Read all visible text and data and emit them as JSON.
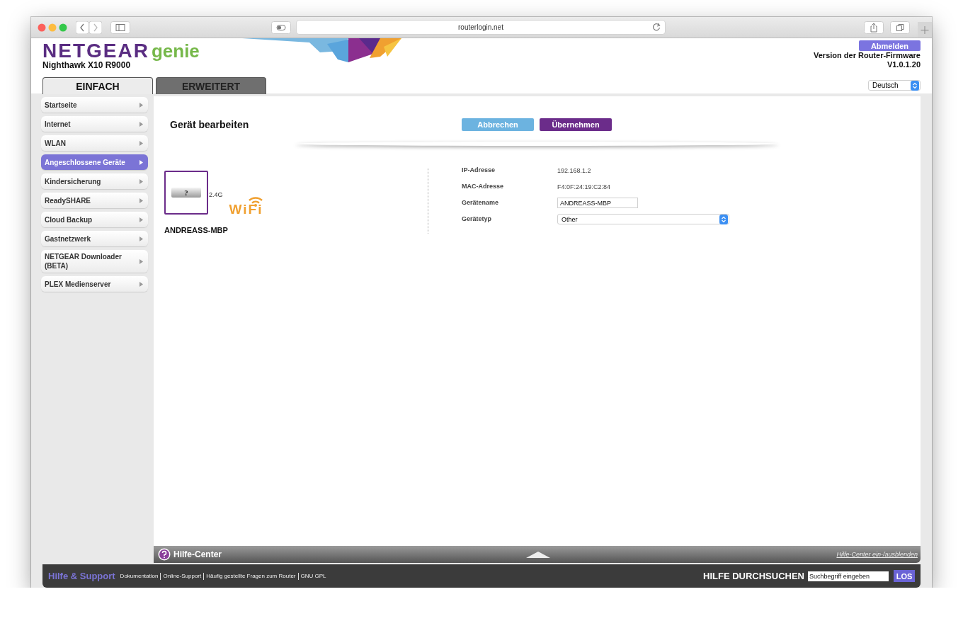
{
  "browser": {
    "url": "routerlogin.net"
  },
  "header": {
    "brand": "NETGEAR",
    "product": "genie",
    "model": "Nighthawk X10 R9000",
    "logout": "Abmelden",
    "firmware_label": "Version der Router-Firmware",
    "firmware_version": "V1.0.1.20",
    "language": "Deutsch"
  },
  "tabs": [
    {
      "label": "EINFACH",
      "selected": true
    },
    {
      "label": "ERWEITERT",
      "selected": false
    }
  ],
  "sidebar": {
    "items": [
      {
        "label": "Startseite",
        "selected": false
      },
      {
        "label": "Internet",
        "selected": false
      },
      {
        "label": "WLAN",
        "selected": false
      },
      {
        "label": "Angeschlossene Geräte",
        "selected": true
      },
      {
        "label": "Kindersicherung",
        "selected": false
      },
      {
        "label": "ReadySHARE",
        "selected": false
      },
      {
        "label": "Cloud Backup",
        "selected": false
      },
      {
        "label": "Gastnetzwerk",
        "selected": false
      },
      {
        "label": "NETGEAR Downloader (BETA)",
        "selected": false
      },
      {
        "label": "PLEX Medienserver",
        "selected": false
      }
    ]
  },
  "main": {
    "title": "Gerät bearbeiten",
    "buttons": [
      {
        "label": "Abbrechen",
        "kind": "cancel"
      },
      {
        "label": "Übernehmen",
        "kind": "apply"
      }
    ],
    "device": {
      "mark": "?",
      "band": "2.4G",
      "wifi": "WiFi",
      "name": "ANDREASS-MBP"
    },
    "fields": [
      {
        "label": "IP-Adresse",
        "kind": "text",
        "value": "192.168.1.2"
      },
      {
        "label": "MAC-Adresse",
        "kind": "text",
        "value": "F4:0F:24:19:C2:84"
      },
      {
        "label": "Gerätename",
        "kind": "input",
        "value": "ANDREASS-MBP"
      },
      {
        "label": "Gerätetyp",
        "kind": "select",
        "value": "Other"
      }
    ]
  },
  "help_bar": {
    "title": "Hilfe-Center",
    "toggle": "Hilfe-Center ein-/ausblenden"
  },
  "footer": {
    "title": "Hilfe & Support",
    "links": [
      "Dokumentation",
      "Online-Support",
      "Häufig gestellte Fragen zum Router",
      "GNU GPL"
    ],
    "search_label": "HILFE DURCHSUCHEN",
    "search_placeholder": "Suchbegriff eingeben",
    "search_button": "LOS"
  }
}
